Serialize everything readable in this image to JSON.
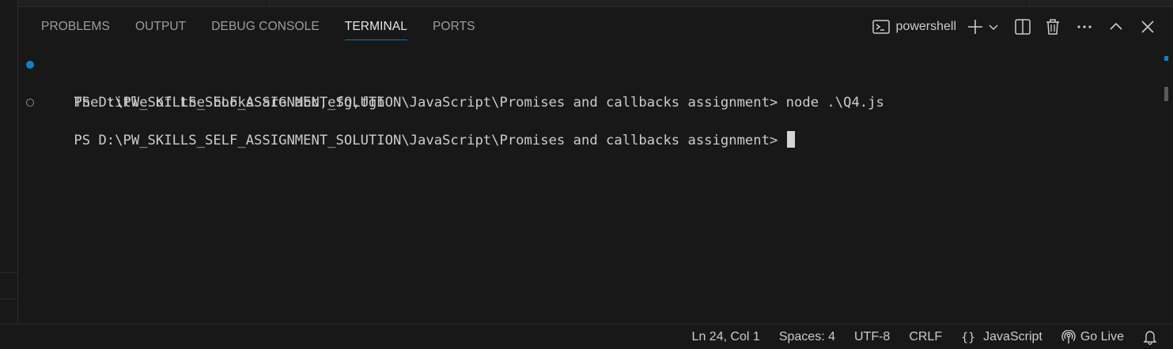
{
  "panel": {
    "tabs": [
      {
        "label": "PROBLEMS"
      },
      {
        "label": "OUTPUT"
      },
      {
        "label": "DEBUG CONSOLE"
      },
      {
        "label": "TERMINAL",
        "active": true
      },
      {
        "label": "PORTS"
      }
    ],
    "toolbar": {
      "shell_label": "powershell",
      "icons": [
        "terminal-icon",
        "plus-icon",
        "chevron-down-icon",
        "split-icon",
        "trash-icon",
        "more-icon",
        "chevron-up-icon",
        "close-icon"
      ]
    }
  },
  "terminal": {
    "lines": [
      {
        "decoration": "success",
        "text": "PS D:\\PW_SKILLS_SELF_ASSIGNMENT_SOLUTION\\JavaScript\\Promises and callbacks assignment> node .\\Q4.js"
      },
      {
        "decoration": "none",
        "text": "The title of the books are abc,efg,fgh"
      },
      {
        "decoration": "empty",
        "text": "PS D:\\PW_SKILLS_SELF_ASSIGNMENT_SOLUTION\\JavaScript\\Promises and callbacks assignment> "
      }
    ]
  },
  "statusbar": {
    "position": "Ln 24, Col 1",
    "spaces": "Spaces: 4",
    "encoding": "UTF-8",
    "eol": "CRLF",
    "language_braces": "{}",
    "language": "JavaScript",
    "golive": "Go Live"
  },
  "colors": {
    "background": "#181818",
    "accent": "#0078d4",
    "success_decoration": "#0f82c3"
  }
}
